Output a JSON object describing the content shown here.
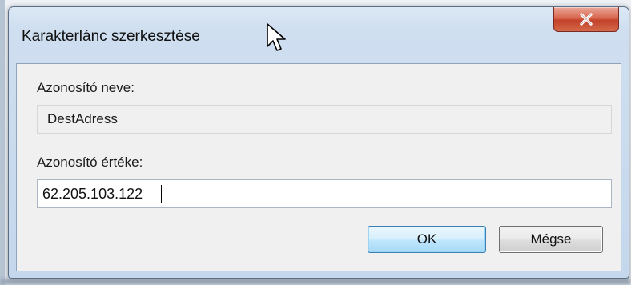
{
  "window": {
    "title": "Karakterlánc szerkesztése"
  },
  "form": {
    "name_label": "Azonosító neve:",
    "name_value": "DestAdress",
    "value_label": "Azonosító értéke:",
    "value_value": "62.205.103.122"
  },
  "buttons": {
    "ok_label": "OK",
    "cancel_label": "Mégse"
  },
  "icons": {
    "close": "close-icon",
    "cursor": "mouse-pointer-icon"
  },
  "colors": {
    "close_button": "#c2412a",
    "ok_border": "#3c7fb1",
    "title_bar": "#cfdff0"
  }
}
